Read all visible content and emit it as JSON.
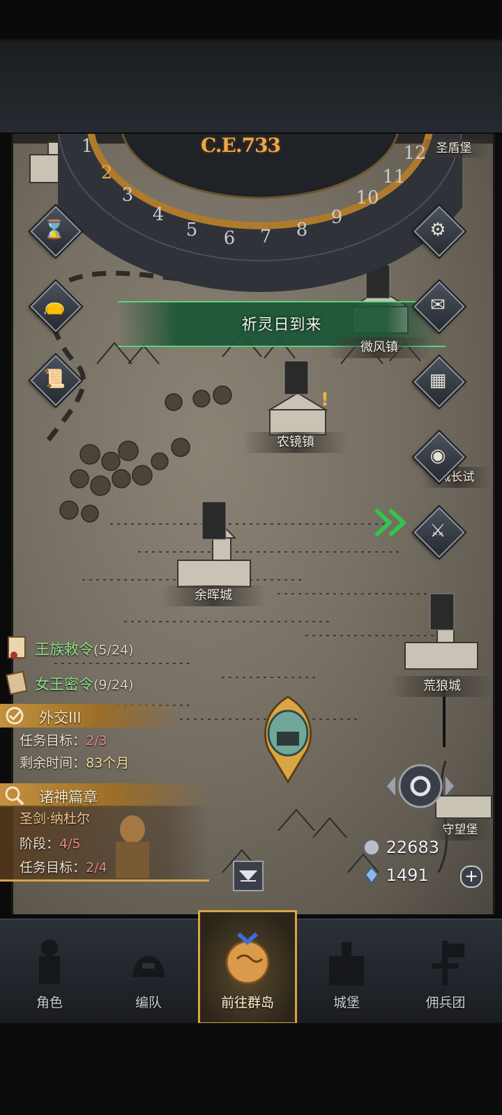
{
  "calendar": {
    "era": "C.E.733",
    "months": [
      "1",
      "2",
      "3",
      "4",
      "5",
      "6",
      "7",
      "8",
      "9",
      "10",
      "11",
      "12"
    ],
    "current_month": "2"
  },
  "event_banner": {
    "text": "祈灵日到来"
  },
  "locations": [
    {
      "name": "微风镇"
    },
    {
      "name": "农镜镇"
    },
    {
      "name": "余晖城"
    },
    {
      "name": "荒狼城"
    },
    {
      "name": "城长试"
    },
    {
      "name": "守望堡"
    },
    {
      "name": "圣盾堡"
    }
  ],
  "left_buttons": [
    "hourglass-icon",
    "money-bag-icon",
    "scroll-icon"
  ],
  "right_buttons": [
    "settings-gear-icon",
    "mail-icon",
    "frame-icon",
    "coin-icon",
    "helmet-sword-icon"
  ],
  "quests": [
    {
      "title": "王族敕令",
      "count": "(5/24)"
    },
    {
      "title": "女王密令",
      "count": "(9/24)"
    }
  ],
  "diplomacy": {
    "title": "外交III",
    "target_label": "任务目标：",
    "target_value": "2/3",
    "time_label": "剩余时间：",
    "time_value": "83个月"
  },
  "saga": {
    "title": "诸神篇章",
    "hero": "圣剑·纳杜尔",
    "stage_label": "阶段：",
    "stage_value": "4/5",
    "target_label": "任务目标：",
    "target_value": "2/4"
  },
  "resources": {
    "silver": "22683",
    "crystal": "1491"
  },
  "nav": [
    {
      "label": "角色"
    },
    {
      "label": "编队"
    },
    {
      "label": "前往群岛"
    },
    {
      "label": "城堡"
    },
    {
      "label": "佣兵团"
    }
  ],
  "colors": {
    "accent_gold": "#e9a84a",
    "quest_green": "#8de08a",
    "banner_green": "#58d47c"
  }
}
